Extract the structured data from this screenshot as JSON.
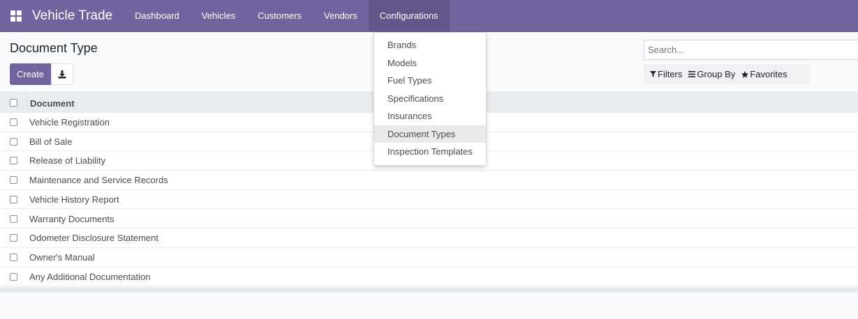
{
  "app": {
    "title": "Vehicle Trade"
  },
  "nav": {
    "items": [
      {
        "label": "Dashboard"
      },
      {
        "label": "Vehicles"
      },
      {
        "label": "Customers"
      },
      {
        "label": "Vendors"
      },
      {
        "label": "Configurations",
        "active": true
      }
    ]
  },
  "page": {
    "title": "Document Type"
  },
  "toolbar": {
    "create_label": "Create"
  },
  "search": {
    "placeholder": "Search..."
  },
  "filters": {
    "filters_label": "Filters",
    "group_by_label": "Group By",
    "favorites_label": "Favorites"
  },
  "table": {
    "column_header": "Document",
    "rows": [
      "Vehicle Registration",
      "Bill of Sale",
      "Release of Liability",
      "Maintenance and Service Records",
      "Vehicle History Report",
      "Warranty Documents",
      "Odometer Disclosure Statement",
      "Owner's Manual",
      "Any Additional Documentation"
    ]
  },
  "dropdown": {
    "items": [
      {
        "label": "Brands"
      },
      {
        "label": "Models"
      },
      {
        "label": "Fuel Types"
      },
      {
        "label": "Specifications"
      },
      {
        "label": "Insurances"
      },
      {
        "label": "Document Types",
        "active": true
      },
      {
        "label": "Inspection Templates"
      }
    ]
  },
  "icons": {
    "apps": "apps-grid-icon",
    "download": "download-icon",
    "filter": "filter-icon",
    "group_by": "bars-icon",
    "favorites": "star-icon"
  },
  "colors": {
    "brand": "#71639e",
    "nav_active": "#62568b"
  }
}
